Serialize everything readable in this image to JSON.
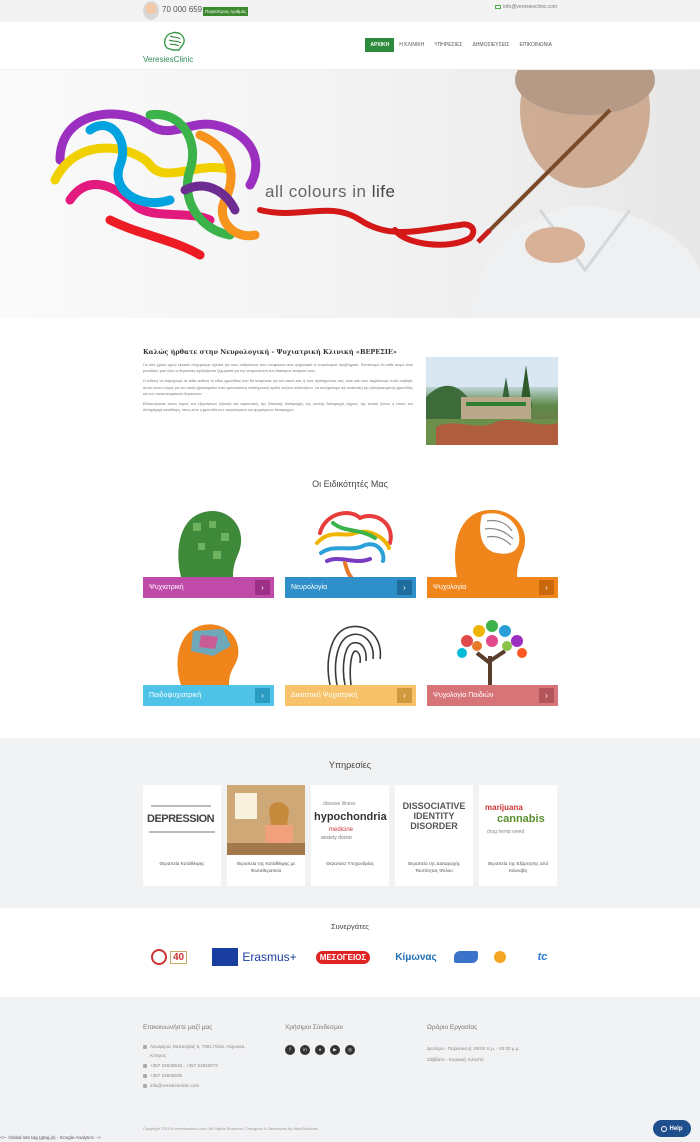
{
  "topbar": {
    "phone": "70 000 659",
    "badge": "Παγκύπριος Αριθμός",
    "email": "info@veresiesclinic.com"
  },
  "header": {
    "logo_text": "VeresiesClinic",
    "nav": [
      "ΑΡΧΙΚΗ",
      "Η ΚΛΙΝΙΚΗ",
      "ΥΠΗΡΕΣΙΕΣ",
      "ΔΗΜΟΣΙΕΥΣΕΙΣ",
      "ΕΠΙΚΟΙΝΩΝΙΑ"
    ]
  },
  "hero": {
    "tagline_start": "all colours in ",
    "tagline_end": "life"
  },
  "welcome": {
    "title": "Καλώς ήρθατε στην Νευρολογική - Ψυχιατρική Κλινική «ΒΕΡΕΣΙΕ»",
    "paragraphs": [
      "Για όσο χρόνο ημών είμαστε επιχειρούμε σχετικά για τους ανθρώπους που υποφέρουν από ψυχιατρικά ή νευρολογικά προβλήματα. Πιστεύουμε ότι κάθε άτομο είναι μοναδικό, γιατί όλες οι θεραπείες σχεδιάζονται ξεχωριστά για την αντιμετώπιση των ιδιαίτερων αναγκών τους.",
      "Η ευθύνη να παρέχουμε σε κάθε ασθενή το είδος φροντίδας που θα αναμένατε για τον εαυτό σας ή τους αγαπημένους σας, είναι κάτι που λαμβάνουμε πολύ σοβαρά. Αυτός είναι ο λόγος για τον οποίο βρισκόμαστε στον εμπιστοσύνη επιστημονική ομάδα πολλών ειδικοτήτων, να συνεχίσουμε την ανάπτυξη της εξατομικευμένης φροντίδας και των αποτελεσματικών θεραπειών.",
      "Ειδικευόμαστε στους τομείς των εξαρτήσεων (αλκοόλ και ναρκωτικά), της διπολικής διαταραχής, της γενικής διαταραχής άγχους, της ανοίας (όπως η νόσος του Αλτσχάιμερ) κατάθλιψη, όπως είναι η φροντίδα των νευρολογικών και ψυχιατρικών διαταραχών."
    ]
  },
  "specialties": {
    "title": "Οι Ειδικότητές Μας",
    "items": [
      {
        "label": "Ψυχιατρική",
        "color": "#c04aa8"
      },
      {
        "label": "Νευρολογία",
        "color": "#2f8fc9"
      },
      {
        "label": "Ψυχολογία",
        "color": "#f0851c"
      },
      {
        "label": "Παιδοψυχιατρική",
        "color": "#4fc2e8"
      },
      {
        "label": "Δικαστική Ψυχιατρική",
        "color": "#f6c36b"
      },
      {
        "label": "Ψυχολογία Παιδιών",
        "color": "#d77478"
      }
    ]
  },
  "services": {
    "title": "Υπηρεσίες",
    "items": [
      {
        "label": "Θεραπεία Κατάθλιψης",
        "image_text": "DEPRESSION"
      },
      {
        "label": "Θεραπεία της Κατάθλιψης με Φωτοθεραπεία",
        "image_text": ""
      },
      {
        "label": "Θεραπεία Υποχονδρίας",
        "image_text": "hypochondria"
      },
      {
        "label": "Θεραπεία της Διαταραχής Ταυτότητας Φύλου",
        "image_text": "DISSOCIATIVE IDENTITY DISORDER"
      },
      {
        "label": "Θεραπεία της Εξάρτησης από Κάνναβη",
        "image_text": "cannabis"
      }
    ]
  },
  "partners": {
    "title": "Συνεργάτες",
    "items": [
      "40",
      "Erasmus+",
      "ΜΕΣΟΓΕΙΟΣ",
      "Κίμωνας",
      "",
      "",
      "tc"
    ]
  },
  "footer": {
    "contact_title": "Επικοινωνήστε μαζί μας",
    "address_line1": "Λεωφόρος Μεσαορίας 5, 7081 Πύλα, Λάρνακα,",
    "address_line2": "Κύπρος",
    "phones": "+357 24645533 , +357 24820072",
    "fax": "+357 24645535",
    "email": "info@veresiesclinic.com",
    "links_title": "Χρήσιμοι Σύνδεσμοι",
    "social": [
      "f",
      "in",
      "♦",
      "▶",
      "◎"
    ],
    "hours_title": "Ωράριο Εργασίας",
    "hours_weekdays": "Δευτέρα - Παρασκευή: 09:00 π.μ. - 20:00 μ.μ.",
    "hours_weekend": "Σάββατο - Κυριακή: Κλειστό",
    "copyright": "Copyright ©2019 veresiesclinic.com. All Rights Reserved. Designed & Developed by WebSolutions",
    "gtag": "<!-- Global site tag (gtag.js) - Google Analytics -->",
    "help": "Help"
  }
}
